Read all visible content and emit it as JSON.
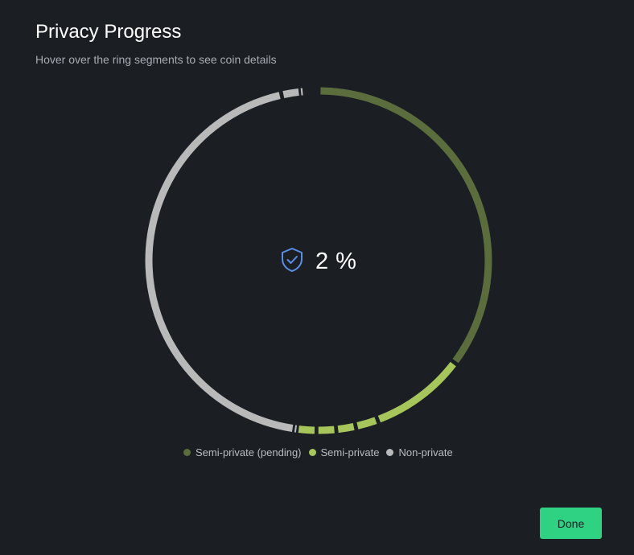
{
  "dialog": {
    "title": "Privacy Progress",
    "subtitle": "Hover over the ring segments to see coin details"
  },
  "progress": {
    "percent_text": "2 %",
    "percent_value": 2,
    "icon": "shield-check-icon"
  },
  "legend": [
    {
      "label": "Semi-private (pending)",
      "color": "#5b6d3d"
    },
    {
      "label": "Semi-private",
      "color": "#a6c55a"
    },
    {
      "label": "Non-private",
      "color": "#b9b9b9"
    }
  ],
  "ring_segments": [
    {
      "category": "Semi-private (pending)",
      "color": "#5b6d3d",
      "fraction": 0.3525
    },
    {
      "category": "Semi-private",
      "color": "#a6c55a",
      "fraction": 0.0911
    },
    {
      "category": "Semi-private",
      "color": "#a6c55a",
      "fraction": 0.0214
    },
    {
      "category": "Semi-private",
      "color": "#a6c55a",
      "fraction": 0.0185
    },
    {
      "category": "Semi-private",
      "color": "#a6c55a",
      "fraction": 0.0185
    },
    {
      "category": "Semi-private",
      "color": "#a6c55a",
      "fraction": 0.0185
    },
    {
      "category": "Non-private",
      "color": "#b9b9b9",
      "fraction": 0.0022
    },
    {
      "category": "Non-private",
      "color": "#b9b9b9",
      "fraction": 0.4423
    },
    {
      "category": "Non-private",
      "color": "#b9b9b9",
      "fraction": 0.0181
    },
    {
      "category": "Non-private",
      "color": "#b9b9b9",
      "fraction": 0.0023
    }
  ],
  "actions": {
    "done_label": "Done"
  },
  "colors": {
    "background": "#1b1f24",
    "accent": "#2fd183",
    "shield": "#5b8ee6"
  }
}
